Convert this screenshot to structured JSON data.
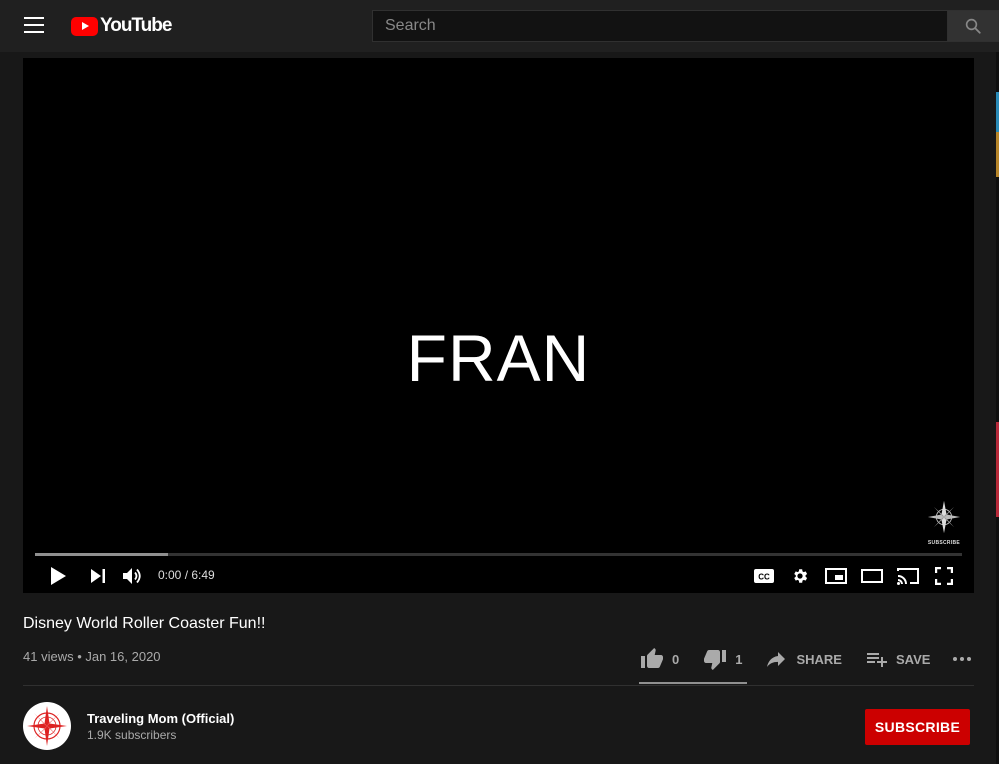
{
  "header": {
    "logo_text": "YouTube",
    "search_placeholder": "Search"
  },
  "player": {
    "frame_text": "FRAN",
    "watermark_label": "SUBSCRIBE",
    "time_display": "0:00 / 6:49",
    "buffered_fraction": 0.144
  },
  "video": {
    "title": "Disney World Roller Coaster Fun!!",
    "meta": "41 views • Jan 16, 2020",
    "likes": "0",
    "dislikes": "1",
    "share_label": "SHARE",
    "save_label": "SAVE"
  },
  "channel": {
    "name": "Traveling Mom (Official)",
    "subscribers": "1.9K subscribers",
    "subscribe_label": "SUBSCRIBE"
  },
  "colors": {
    "brand_red": "#ff0000",
    "subscribe_red": "#cc0000",
    "background": "#181818",
    "topbar": "#202020"
  }
}
